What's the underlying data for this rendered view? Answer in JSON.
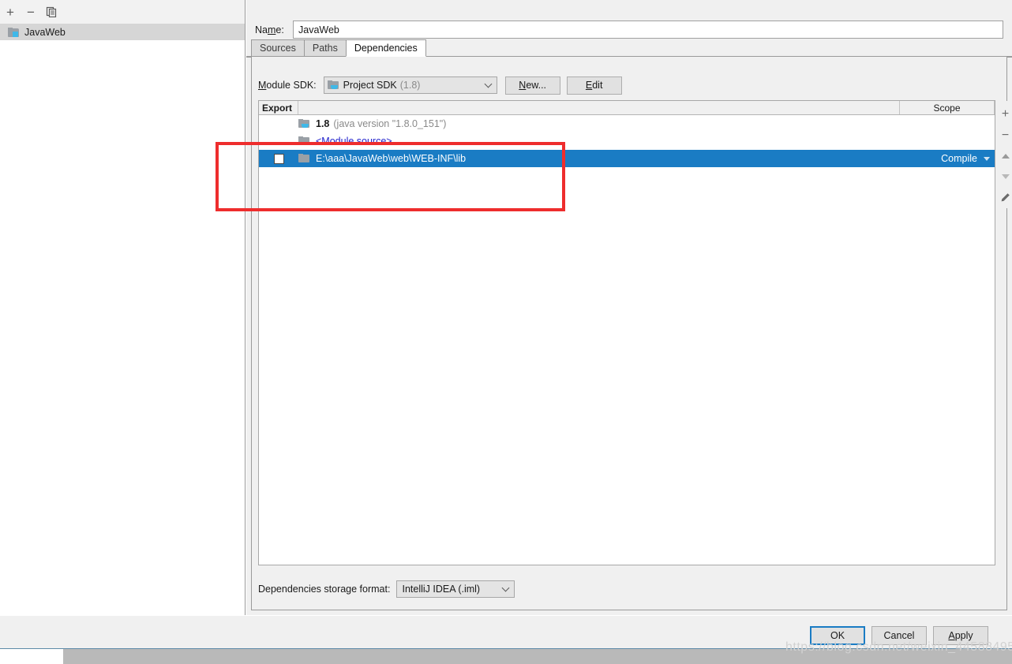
{
  "left_panel": {
    "toolbar": [
      {
        "name": "add-module-button",
        "glyph": "+"
      },
      {
        "name": "remove-module-button",
        "glyph": "−"
      },
      {
        "name": "copy-module-button",
        "glyph": "❐"
      }
    ],
    "modules": [
      {
        "label": "JavaWeb",
        "selected": true
      }
    ]
  },
  "name_field": {
    "label": "Name:",
    "value": "JavaWeb",
    "placeholder": ""
  },
  "tabs": [
    {
      "label": "Sources",
      "active": false
    },
    {
      "label": "Paths",
      "active": false
    },
    {
      "label": "Dependencies",
      "active": true
    }
  ],
  "sdk_row": {
    "label": "Module SDK:",
    "combo_text": "Project SDK",
    "combo_version": "(1.8)",
    "new_button": "New...",
    "edit_button": "Edit"
  },
  "dependency_table": {
    "columns": {
      "export": "Export",
      "name": "",
      "scope": "Scope"
    },
    "rows": [
      {
        "checkbox": false,
        "checkbox_visible": false,
        "icon": "sdk-folder-icon",
        "name": "1.8",
        "name_detail": "(java version \"1.8.0_151\")",
        "scope": "",
        "selected": false,
        "style": "sdk"
      },
      {
        "checkbox": false,
        "checkbox_visible": false,
        "icon": "folder-icon",
        "name": "<Module source>",
        "name_detail": "",
        "scope": "",
        "selected": false,
        "style": "module-source"
      },
      {
        "checkbox": false,
        "checkbox_visible": true,
        "icon": "folder-icon",
        "name": "E:\\aaa\\JavaWeb\\web\\WEB-INF\\lib",
        "name_detail": "",
        "scope": "Compile",
        "selected": true,
        "style": "library"
      }
    ]
  },
  "side_toolbar": [
    {
      "name": "add-dependency-button",
      "glyph": "+"
    },
    {
      "name": "remove-dependency-button",
      "glyph": "−"
    },
    {
      "name": "move-up-button",
      "glyph": "▲"
    },
    {
      "name": "move-down-button",
      "glyph": "▼"
    },
    {
      "name": "edit-dependency-button",
      "glyph": "✎"
    }
  ],
  "storage_row": {
    "label": "Dependencies storage format:",
    "value": "IntelliJ IDEA (.iml)"
  },
  "footer": {
    "ok": "OK",
    "cancel": "Cancel",
    "apply": "Apply"
  },
  "watermark": "https://blog.csdn.net/weixin_44588495",
  "colors": {
    "selection_blue": "#1a7cc4",
    "annotation_red": "#ee2d2d",
    "link_blue": "#2222cc",
    "panel_gray": "#f0f0f0"
  }
}
